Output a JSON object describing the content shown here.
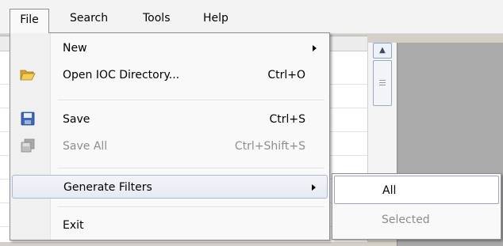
{
  "menubar": {
    "items": [
      {
        "label": "File"
      },
      {
        "label": "Search"
      },
      {
        "label": "Tools"
      },
      {
        "label": "Help"
      }
    ]
  },
  "file_menu": {
    "new": {
      "label": "New"
    },
    "open": {
      "label": "Open IOC Directory...",
      "shortcut": "Ctrl+O"
    },
    "save": {
      "label": "Save",
      "shortcut": "Ctrl+S"
    },
    "save_all": {
      "label": "Save All",
      "shortcut": "Ctrl+Shift+S"
    },
    "generate_filters": {
      "label": "Generate Filters"
    },
    "exit": {
      "label": "Exit"
    }
  },
  "submenu": {
    "all": {
      "label": "All"
    },
    "selected": {
      "label": "Selected"
    }
  },
  "colors": {
    "accent": "#aab7cf",
    "right_pane": "#aaaaaa"
  }
}
